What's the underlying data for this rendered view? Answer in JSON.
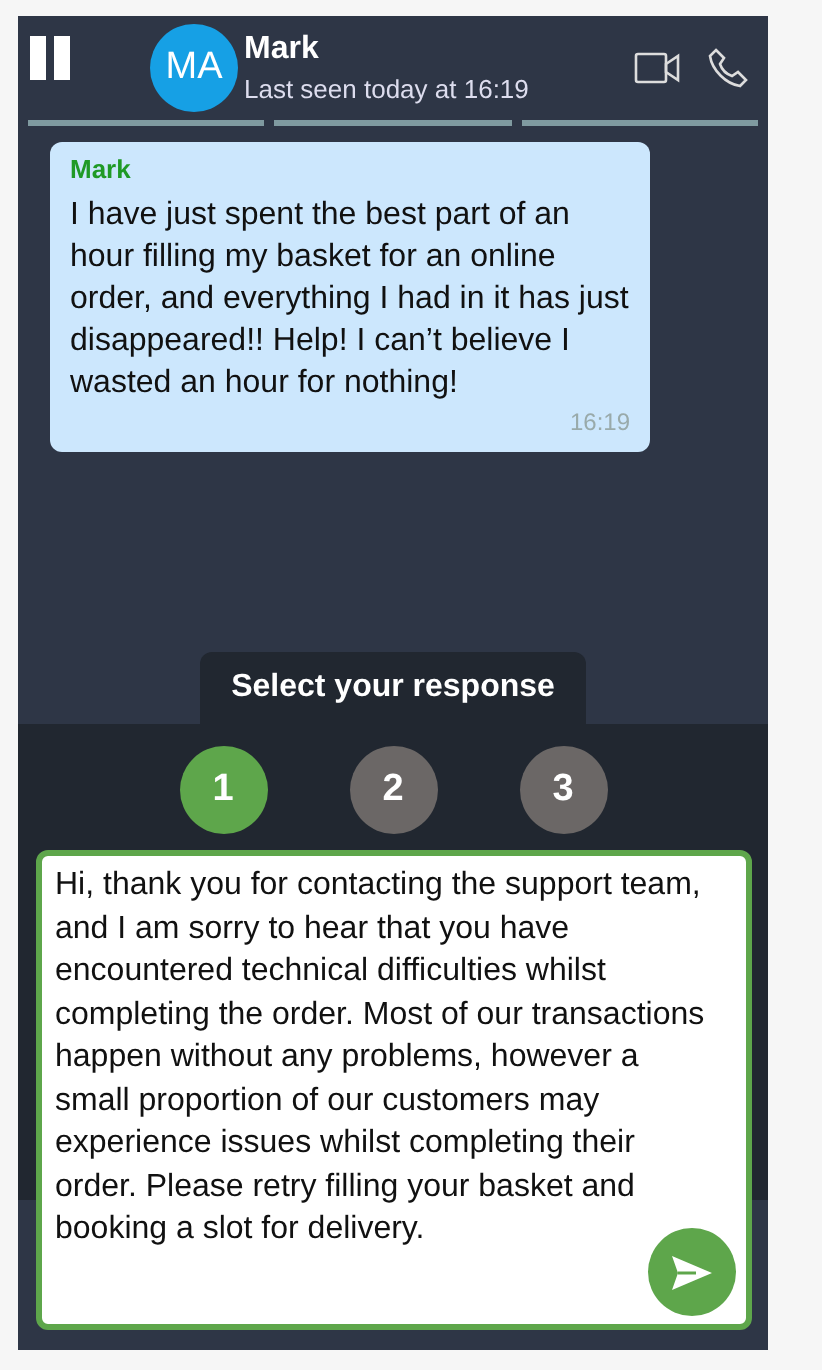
{
  "header": {
    "avatar": "MA",
    "name": "Mark",
    "status": "Last seen today at 16:19"
  },
  "messages": [
    {
      "sender": "Mark",
      "text": "I have just spent the best part of an hour filling my basket for an online order, and everything I had in it has just disappeared!! Help! I can’t believe I wasted an hour for nothing!",
      "time": "16:19"
    }
  ],
  "response_panel": {
    "title": "Select your response",
    "options": [
      {
        "label": "1",
        "selected": true
      },
      {
        "label": "2",
        "selected": false
      },
      {
        "label": "3",
        "selected": false
      }
    ],
    "value": "Hi, thank you for contacting the support team, and I am sorry to hear that you have encountered technical difficulties whilst completing the order. Most of our transactions happen without any problems, however a small proportion of our customers may experience issues whilst completing their order. Please retry filling your basket and booking a slot for delivery."
  }
}
